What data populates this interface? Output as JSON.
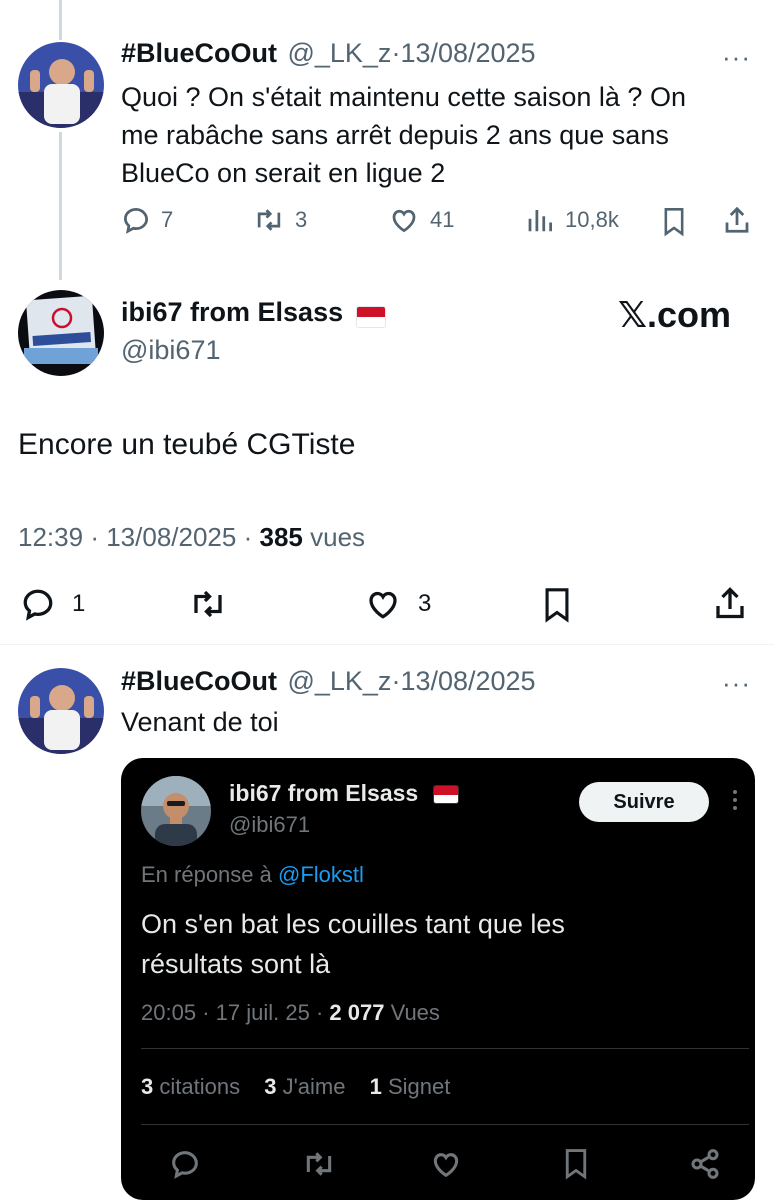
{
  "tweet1": {
    "name": "#BlueCoOut",
    "handle": "@_LK_z",
    "sep": "·",
    "date": "13/08/2025",
    "more": "···",
    "text_line1": "Quoi ? On s'était maintenu cette saison là ? On",
    "text_line2": "me rabâche sans arrêt depuis 2 ans que sans",
    "text_line3": "BlueCo on serait en ligue 2",
    "replies": "7",
    "retweets": "3",
    "likes": "41",
    "views": "10,8k"
  },
  "tweet2": {
    "name": "ibi67 from Elsass",
    "handle": "@ibi671",
    "watermark": "𝕏.com",
    "text": "Encore un teubé CGTiste",
    "time": "12:39",
    "date": "13/08/2025",
    "sep": "·",
    "views_count": "385",
    "views_label": "vues",
    "replies": "1",
    "likes": "3"
  },
  "tweet3": {
    "name": "#BlueCoOut",
    "handle": "@_LK_z",
    "sep": "·",
    "date": "13/08/2025",
    "more": "···",
    "text": "Venant de toi"
  },
  "embed": {
    "name": "ibi67 from Elsass",
    "handle": "@ibi671",
    "follow_label": "Suivre",
    "reply_prefix": "En réponse à",
    "reply_to": "@Flokstl",
    "text_line1": "On s'en bat les couilles tant que les",
    "text_line2": "résultats sont là",
    "time": "20:05",
    "date": "17 juil. 25",
    "sep": "·",
    "views_count": "2 077",
    "views_label": "Vues",
    "quotes_count": "3",
    "quotes_label": "citations",
    "likes_count": "3",
    "likes_label": "J'aime",
    "bookmarks_count": "1",
    "bookmarks_label": "Signet"
  },
  "colors": {
    "text": "#0f1419",
    "muted": "#536471",
    "card_bg": "#000000",
    "card_text": "#e7e9ea",
    "link": "#1d9bf0"
  }
}
